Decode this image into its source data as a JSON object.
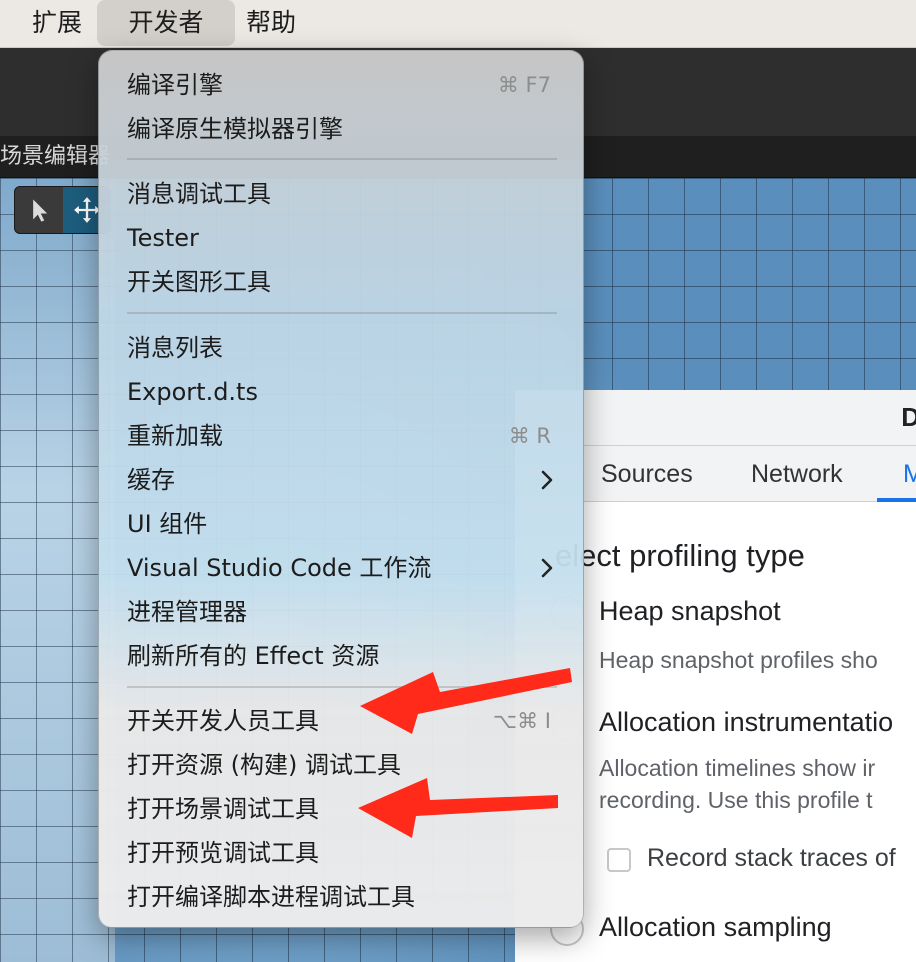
{
  "menubar": {
    "items": [
      "扩展",
      "开发者",
      "帮助"
    ],
    "active_index": 1
  },
  "editor": {
    "scene_tab_label": "场景编辑器"
  },
  "devtools": {
    "title_clip": "D",
    "tabs": [
      "Sources",
      "Network",
      "M"
    ],
    "active_tab": "M",
    "heading": "elect profiling type",
    "options": [
      {
        "label": "Heap snapshot",
        "desc": [
          "Heap snapshot profiles sho"
        ]
      },
      {
        "label": "Allocation instrumentatio",
        "desc": [
          "Allocation timelines show ir",
          "recording. Use this profile t"
        ]
      },
      {
        "label": "Allocation sampling",
        "desc": []
      }
    ],
    "checkbox_label": "Record stack traces of"
  },
  "menu": {
    "items": [
      {
        "label": "编译引擎",
        "shortcut": "⌘ F7"
      },
      {
        "label": "编译原生模拟器引擎",
        "shortcut": ""
      },
      {
        "label": "消息调试工具",
        "shortcut": ""
      },
      {
        "label": "Tester",
        "shortcut": ""
      },
      {
        "label": "开关图形工具",
        "shortcut": ""
      },
      {
        "label": "消息列表",
        "shortcut": ""
      },
      {
        "label": "Export.d.ts",
        "shortcut": ""
      },
      {
        "label": "重新加载",
        "shortcut": "⌘ R"
      },
      {
        "label": "缓存",
        "shortcut": "",
        "submenu": true
      },
      {
        "label": "UI 组件",
        "shortcut": ""
      },
      {
        "label": "Visual Studio Code 工作流",
        "shortcut": "",
        "submenu": true
      },
      {
        "label": "进程管理器",
        "shortcut": ""
      },
      {
        "label": "刷新所有的 Effect 资源",
        "shortcut": ""
      },
      {
        "label": "开关开发人员工具",
        "shortcut": "⌥⌘ I"
      },
      {
        "label": "打开资源 (构建) 调试工具",
        "shortcut": ""
      },
      {
        "label": "打开场景调试工具",
        "shortcut": ""
      },
      {
        "label": "打开预览调试工具",
        "shortcut": ""
      },
      {
        "label": "打开编译脚本进程调试工具",
        "shortcut": ""
      }
    ]
  },
  "annotation": {
    "arrow_color": "#ff2a1a"
  },
  "icons": [
    "pointer-arrow-icon",
    "move-icon",
    "chevron-right-icon"
  ]
}
